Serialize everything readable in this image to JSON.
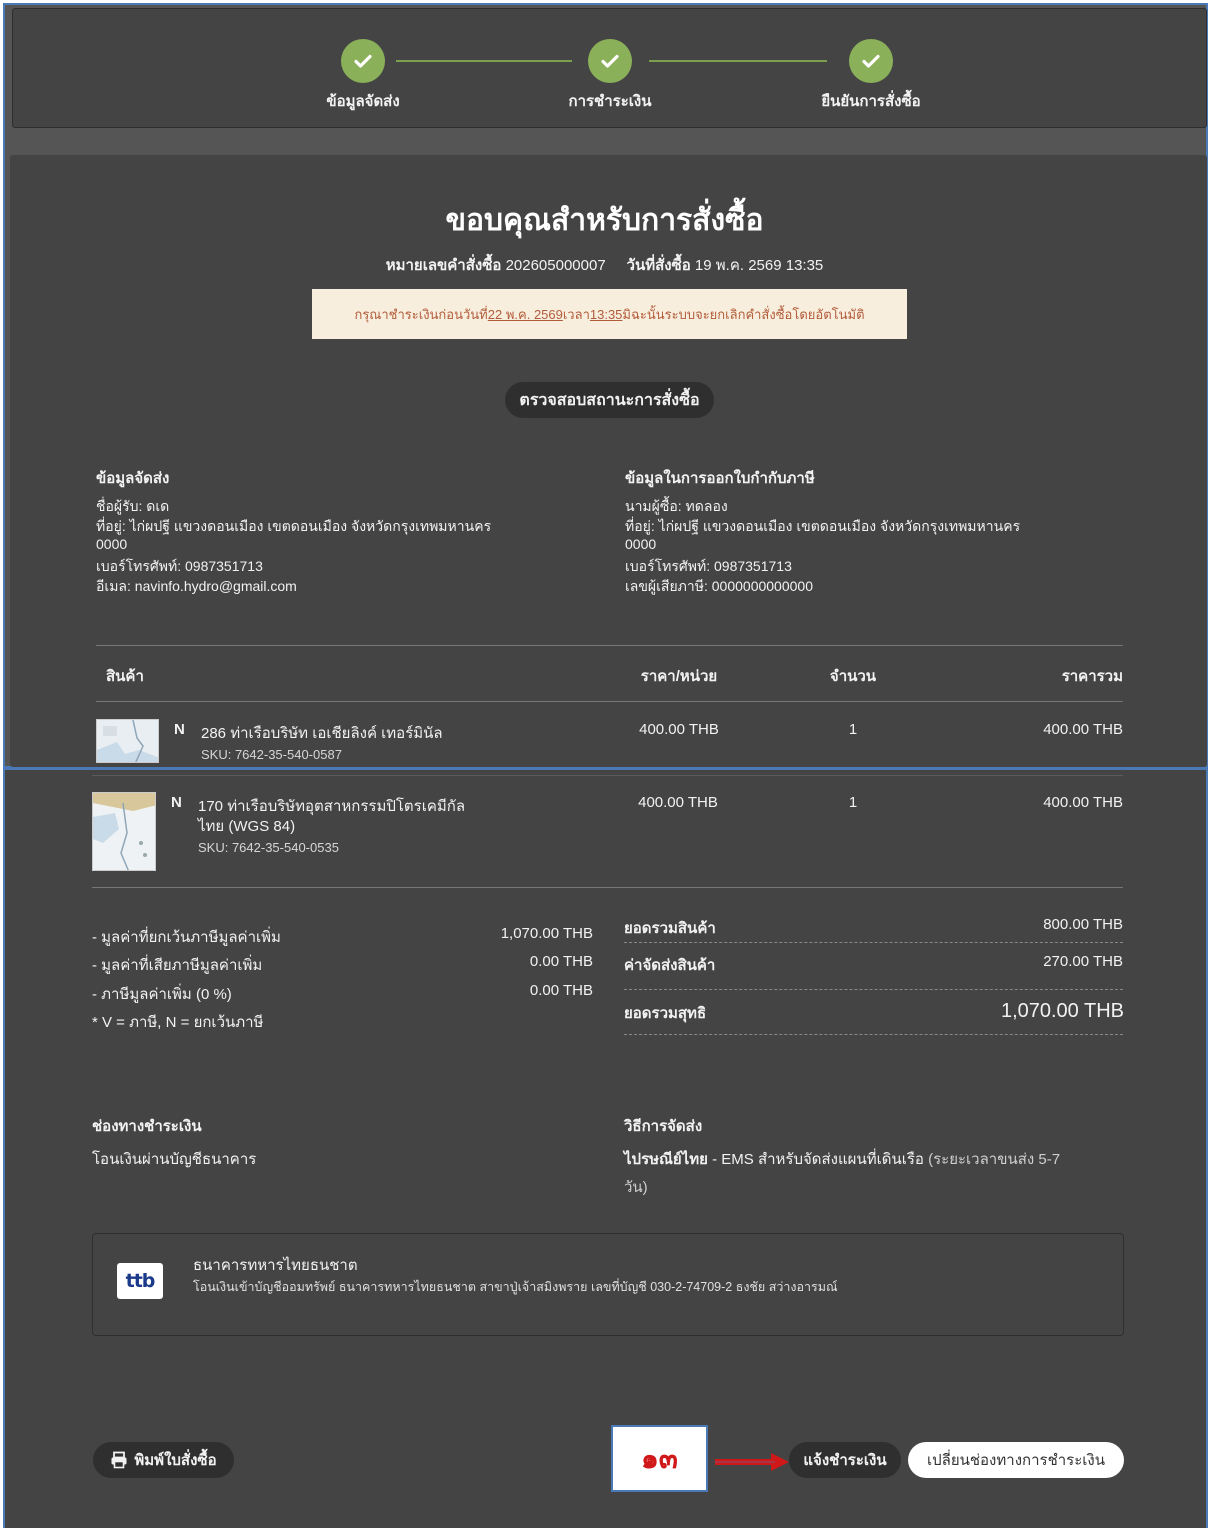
{
  "steps": [
    {
      "label": "ข้อมูลจัดส่ง"
    },
    {
      "label": "การชำระเงิน"
    },
    {
      "label": "ยืนยันการสั่งซื้อ"
    }
  ],
  "page_title": "ขอบคุณสำหรับการสั่งซื้อ",
  "order_meta": {
    "order_no_label": "หมายเลขคำสั่งซื้อ",
    "order_no": "202605000007",
    "date_label": "วันที่สั่งซื้อ",
    "date": "19 พ.ค. 2569 13:35"
  },
  "notice": {
    "pre": "กรุณาชำระเงินก่อนวันที่ ",
    "date": "22 พ.ค. 2569",
    "mid": " เวลา ",
    "time": "13:35",
    "post": " มิฉะนั้นระบบจะยกเลิกคำสั่งซื้อโดยอัตโนมัติ"
  },
  "check_status_button": "ตรวจสอบสถานะการสั่งซื้อ",
  "shipping": {
    "heading": "ข้อมูลจัดส่ง",
    "receiver": "ชื่อผู้รับ: ดเด",
    "address": "ที่อยู่: ไก่ผปฐี แขวงดอนเมือง เขตดอนเมือง จังหวัดกรุงเทพมหานคร",
    "postcode": "0000",
    "phone": "เบอร์โทรศัพท์: 0987351713",
    "email": "อีเมล: navinfo.hydro@gmail.com"
  },
  "tax_invoice": {
    "heading": "ข้อมูลในการออกใบกำกับภาษี",
    "buyer": "นามผู้ซื้อ: ทดลอง",
    "address": "ที่อยู่: ไก่ผปฐี แขวงดอนเมือง เขตดอนเมือง จังหวัดกรุงเทพมหานคร",
    "postcode": "0000",
    "phone": "เบอร์โทรศัพท์: 0987351713",
    "tax_id": "เลขผู้เสียภาษี: 0000000000000"
  },
  "table": {
    "headers": {
      "product": "สินค้า",
      "unit_price": "ราคา/หน่วย",
      "qty": "จำนวน",
      "total": "ราคารวม"
    },
    "rows": [
      {
        "flag": "N",
        "name": "286 ท่าเรือบริษัท เอเชียลิงค์ เทอร์มินัล",
        "sku": "SKU: 7642-35-540-0587",
        "unit_price": "400.00 THB",
        "qty": "1",
        "total": "400.00 THB"
      },
      {
        "flag": "N",
        "name_line1": "170 ท่าเรือบริษัทอุตสาหกรรมปิโตรเคมีกัล",
        "name_line2": "ไทย (WGS 84)",
        "sku": "SKU: 7642-35-540-0535",
        "unit_price": "400.00 THB",
        "qty": "1",
        "total": "400.00 THB"
      }
    ]
  },
  "vat": {
    "exempt_label": "- มูลค่าที่ยกเว้นภาษีมูลค่าเพิ่ม",
    "exempt_value": "1,070.00 THB",
    "taxable_label": "- มูลค่าที่เสียภาษีมูลค่าเพิ่ม",
    "taxable_value": "0.00 THB",
    "vat_label": "- ภาษีมูลค่าเพิ่ม (0 %)",
    "vat_value": "0.00 THB",
    "note": "* V = ภาษี, N = ยกเว้นภาษี"
  },
  "totals": {
    "subtotal_label": "ยอดรวมสินค้า",
    "subtotal_value": "800.00 THB",
    "shipping_label": "ค่าจัดส่งสินค้า",
    "shipping_value": "270.00 THB",
    "net_label": "ยอดรวมสุทธิ",
    "net_value": "1,070.00 THB"
  },
  "payment": {
    "heading": "ช่องทางชำระเงิน",
    "method": "โอนเงินผ่านบัญชีธนาคาร"
  },
  "delivery": {
    "heading": "วิธีการจัดส่ง",
    "carrier": "ไปรษณีย์ไทย",
    "detail": " - EMS สำหรับจัดส่งแผนที่เดินเรือ",
    "duration_line1": " (ระยะเวลาขนส่ง 5-7",
    "duration_line2": "วัน)"
  },
  "bank": {
    "logo_text": "ttb",
    "name": "ธนาคารทหารไทยธนชาต",
    "detail": "โอนเงินเข้าบัญชีออมทรัพย์ ธนาคารทหารไทยธนชาต สาขาปู่เจ้าสมิงพราย เลขที่บัญชี 030-2-74709-2 ธงชัย สว่างอารมณ์"
  },
  "buttons": {
    "print": "พิมพ์ใบสั่งซื้อ",
    "notify_payment": "แจ้งชำระเงิน",
    "change_payment": "เปลี่ยนช่องทางการชำระเงิน"
  },
  "annotation": {
    "label": "๑๓",
    "color": "#d11818"
  },
  "colors": {
    "accent_green": "#8bb05a",
    "panel": "#444444",
    "notice_bg": "#f8eedd",
    "notice_text": "#b25c3b"
  }
}
